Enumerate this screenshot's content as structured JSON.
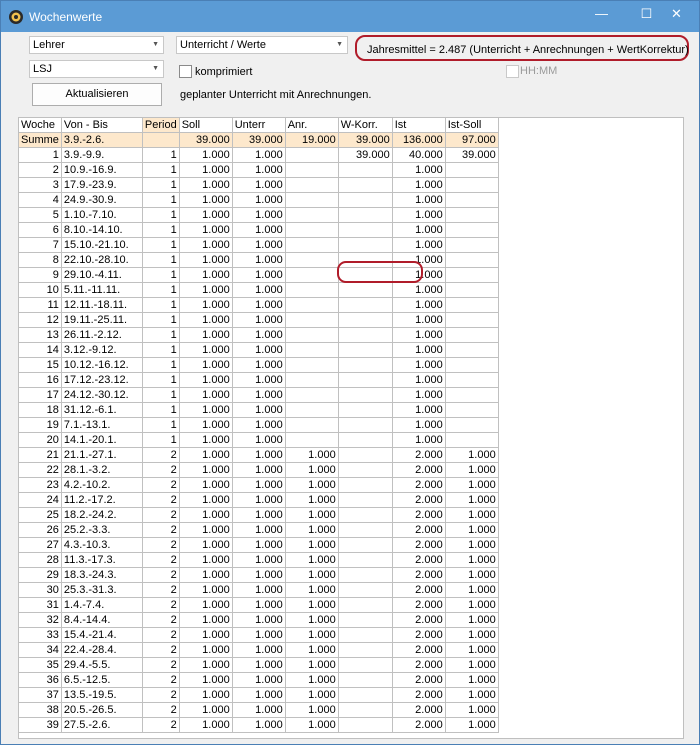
{
  "window": {
    "title": "Wochenwerte",
    "minimize": "—",
    "maximize": "☐",
    "close": "✕"
  },
  "controls": {
    "combo_person_type": "Lehrer",
    "combo_value_type": "Unterricht / Werte",
    "combo_period": "LSJ",
    "checkbox_compressed_label": "komprimiert",
    "checkbox_hhmm_label": "HH:MM",
    "refresh_button": "Aktualisieren",
    "info_text": "geplanter Unterricht mit Anrechnungen.",
    "annual_average": "Jahresmittel = 2.487 (Unterricht + Anrechnungen + WertKorrektur)"
  },
  "table": {
    "headers": [
      "Woche",
      "Von - Bis",
      "Period",
      "Soll",
      "Unterr",
      "Anr.",
      "W-Korr.",
      "Ist",
      "Ist-Soll"
    ],
    "sum": [
      "Summe",
      "3.9.-2.6.",
      "",
      "39.000",
      "39.000",
      "19.000",
      "39.000",
      "136.000",
      "97.000"
    ],
    "rows": [
      [
        "1",
        "3.9.-9.9.",
        "1",
        "1.000",
        "1.000",
        "",
        "39.000",
        "40.000",
        "39.000"
      ],
      [
        "2",
        "10.9.-16.9.",
        "1",
        "1.000",
        "1.000",
        "",
        "",
        "1.000",
        ""
      ],
      [
        "3",
        "17.9.-23.9.",
        "1",
        "1.000",
        "1.000",
        "",
        "",
        "1.000",
        ""
      ],
      [
        "4",
        "24.9.-30.9.",
        "1",
        "1.000",
        "1.000",
        "",
        "",
        "1.000",
        ""
      ],
      [
        "5",
        "1.10.-7.10.",
        "1",
        "1.000",
        "1.000",
        "",
        "",
        "1.000",
        ""
      ],
      [
        "6",
        "8.10.-14.10.",
        "1",
        "1.000",
        "1.000",
        "",
        "",
        "1.000",
        ""
      ],
      [
        "7",
        "15.10.-21.10.",
        "1",
        "1.000",
        "1.000",
        "",
        "",
        "1.000",
        ""
      ],
      [
        "8",
        "22.10.-28.10.",
        "1",
        "1.000",
        "1.000",
        "",
        "",
        "1.000",
        ""
      ],
      [
        "9",
        "29.10.-4.11.",
        "1",
        "1.000",
        "1.000",
        "",
        "",
        "1.000",
        ""
      ],
      [
        "10",
        "5.11.-11.11.",
        "1",
        "1.000",
        "1.000",
        "",
        "",
        "1.000",
        ""
      ],
      [
        "11",
        "12.11.-18.11.",
        "1",
        "1.000",
        "1.000",
        "",
        "",
        "1.000",
        ""
      ],
      [
        "12",
        "19.11.-25.11.",
        "1",
        "1.000",
        "1.000",
        "",
        "",
        "1.000",
        ""
      ],
      [
        "13",
        "26.11.-2.12.",
        "1",
        "1.000",
        "1.000",
        "",
        "",
        "1.000",
        ""
      ],
      [
        "14",
        "3.12.-9.12.",
        "1",
        "1.000",
        "1.000",
        "",
        "",
        "1.000",
        ""
      ],
      [
        "15",
        "10.12.-16.12.",
        "1",
        "1.000",
        "1.000",
        "",
        "",
        "1.000",
        ""
      ],
      [
        "16",
        "17.12.-23.12.",
        "1",
        "1.000",
        "1.000",
        "",
        "",
        "1.000",
        ""
      ],
      [
        "17",
        "24.12.-30.12.",
        "1",
        "1.000",
        "1.000",
        "",
        "",
        "1.000",
        ""
      ],
      [
        "18",
        "31.12.-6.1.",
        "1",
        "1.000",
        "1.000",
        "",
        "",
        "1.000",
        ""
      ],
      [
        "19",
        "7.1.-13.1.",
        "1",
        "1.000",
        "1.000",
        "",
        "",
        "1.000",
        ""
      ],
      [
        "20",
        "14.1.-20.1.",
        "1",
        "1.000",
        "1.000",
        "",
        "",
        "1.000",
        ""
      ],
      [
        "21",
        "21.1.-27.1.",
        "2",
        "1.000",
        "1.000",
        "1.000",
        "",
        "2.000",
        "1.000"
      ],
      [
        "22",
        "28.1.-3.2.",
        "2",
        "1.000",
        "1.000",
        "1.000",
        "",
        "2.000",
        "1.000"
      ],
      [
        "23",
        "4.2.-10.2.",
        "2",
        "1.000",
        "1.000",
        "1.000",
        "",
        "2.000",
        "1.000"
      ],
      [
        "24",
        "11.2.-17.2.",
        "2",
        "1.000",
        "1.000",
        "1.000",
        "",
        "2.000",
        "1.000"
      ],
      [
        "25",
        "18.2.-24.2.",
        "2",
        "1.000",
        "1.000",
        "1.000",
        "",
        "2.000",
        "1.000"
      ],
      [
        "26",
        "25.2.-3.3.",
        "2",
        "1.000",
        "1.000",
        "1.000",
        "",
        "2.000",
        "1.000"
      ],
      [
        "27",
        "4.3.-10.3.",
        "2",
        "1.000",
        "1.000",
        "1.000",
        "",
        "2.000",
        "1.000"
      ],
      [
        "28",
        "11.3.-17.3.",
        "2",
        "1.000",
        "1.000",
        "1.000",
        "",
        "2.000",
        "1.000"
      ],
      [
        "29",
        "18.3.-24.3.",
        "2",
        "1.000",
        "1.000",
        "1.000",
        "",
        "2.000",
        "1.000"
      ],
      [
        "30",
        "25.3.-31.3.",
        "2",
        "1.000",
        "1.000",
        "1.000",
        "",
        "2.000",
        "1.000"
      ],
      [
        "31",
        "1.4.-7.4.",
        "2",
        "1.000",
        "1.000",
        "1.000",
        "",
        "2.000",
        "1.000"
      ],
      [
        "32",
        "8.4.-14.4.",
        "2",
        "1.000",
        "1.000",
        "1.000",
        "",
        "2.000",
        "1.000"
      ],
      [
        "33",
        "15.4.-21.4.",
        "2",
        "1.000",
        "1.000",
        "1.000",
        "",
        "2.000",
        "1.000"
      ],
      [
        "34",
        "22.4.-28.4.",
        "2",
        "1.000",
        "1.000",
        "1.000",
        "",
        "2.000",
        "1.000"
      ],
      [
        "35",
        "29.4.-5.5.",
        "2",
        "1.000",
        "1.000",
        "1.000",
        "",
        "2.000",
        "1.000"
      ],
      [
        "36",
        "6.5.-12.5.",
        "2",
        "1.000",
        "1.000",
        "1.000",
        "",
        "2.000",
        "1.000"
      ],
      [
        "37",
        "13.5.-19.5.",
        "2",
        "1.000",
        "1.000",
        "1.000",
        "",
        "2.000",
        "1.000"
      ],
      [
        "38",
        "20.5.-26.5.",
        "2",
        "1.000",
        "1.000",
        "1.000",
        "",
        "2.000",
        "1.000"
      ],
      [
        "39",
        "27.5.-2.6.",
        "2",
        "1.000",
        "1.000",
        "1.000",
        "",
        "2.000",
        "1.000"
      ]
    ]
  }
}
